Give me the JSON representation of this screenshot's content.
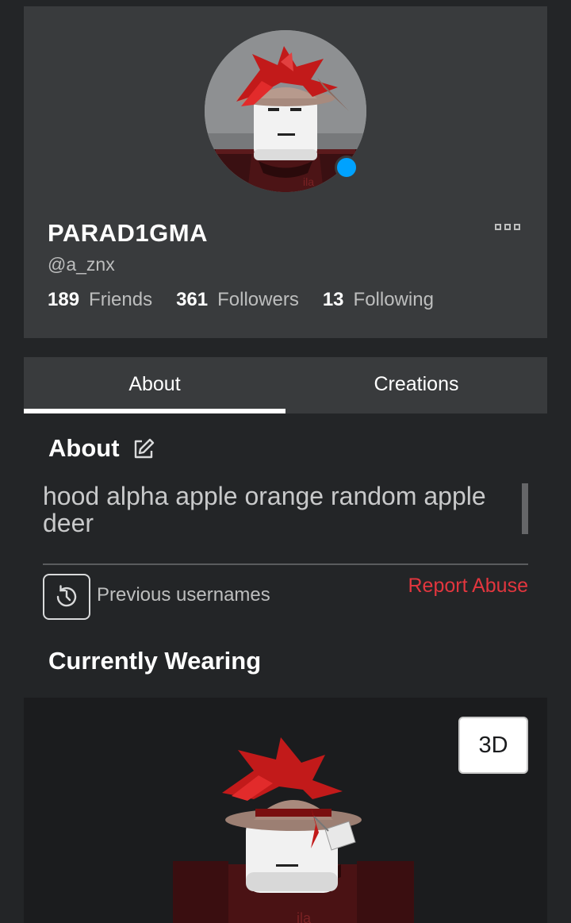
{
  "profile": {
    "display_name": "PARAD1GMA",
    "username": "@a_znx",
    "online_status_color": "#00a2ff",
    "stats": [
      {
        "count": "189",
        "label": "Friends"
      },
      {
        "count": "361",
        "label": "Followers"
      },
      {
        "count": "13",
        "label": "Following"
      }
    ]
  },
  "tabs": [
    {
      "label": "About",
      "active": true
    },
    {
      "label": "Creations",
      "active": false
    }
  ],
  "about": {
    "title": "About",
    "description": "hood alpha apple orange random apple deer",
    "previous_usernames_label": "Previous usernames",
    "report_label": "Report Abuse",
    "report_color": "#e2363e"
  },
  "wearing": {
    "title": "Currently Wearing",
    "view_toggle_label": "3D"
  },
  "icons": [
    "more-icon",
    "edit-icon",
    "history-icon"
  ]
}
